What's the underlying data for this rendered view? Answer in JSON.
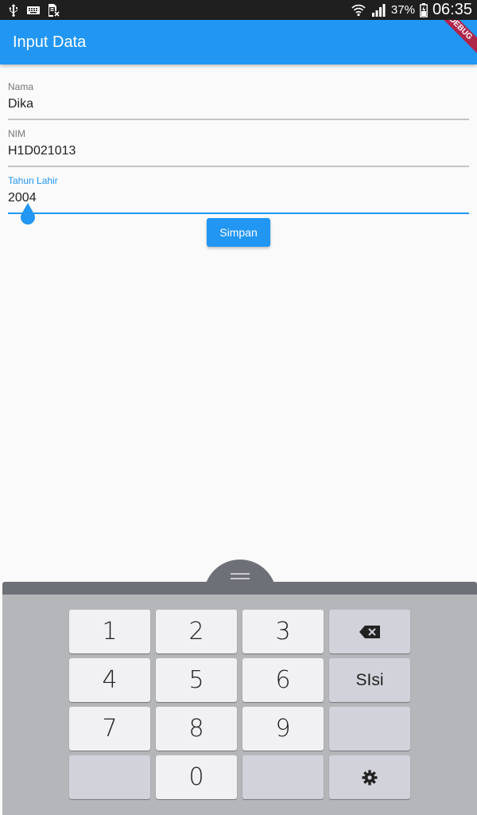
{
  "status_bar": {
    "icons_left": [
      "usb-icon",
      "keyboard-icon",
      "sim-card-icon"
    ],
    "icons_right": [
      "wifi-icon",
      "signal-icon",
      "battery-icon"
    ],
    "battery_percent": "37%",
    "time": "06:35"
  },
  "app_bar": {
    "title": "Input Data",
    "debug_banner": "DEBUG"
  },
  "form": {
    "nama": {
      "label": "Nama",
      "value": "Dika"
    },
    "nim": {
      "label": "NIM",
      "value": "H1D021013"
    },
    "tahun_lahir": {
      "label": "Tahun Lahir",
      "value": "2004"
    },
    "save_label": "Simpan"
  },
  "keyboard": {
    "keys": {
      "k1": "1",
      "k2": "2",
      "k3": "3",
      "k4": "4",
      "k5": "5",
      "k6": "6",
      "k7": "7",
      "k8": "8",
      "k9": "9",
      "k0": "0",
      "done": "SIsi"
    },
    "icons": {
      "backspace": "backspace-icon",
      "settings": "settings-icon"
    }
  },
  "colors": {
    "primary": "#2196f3",
    "banner": "#b0264b",
    "keyboard_bg": "#b5b6ba"
  }
}
